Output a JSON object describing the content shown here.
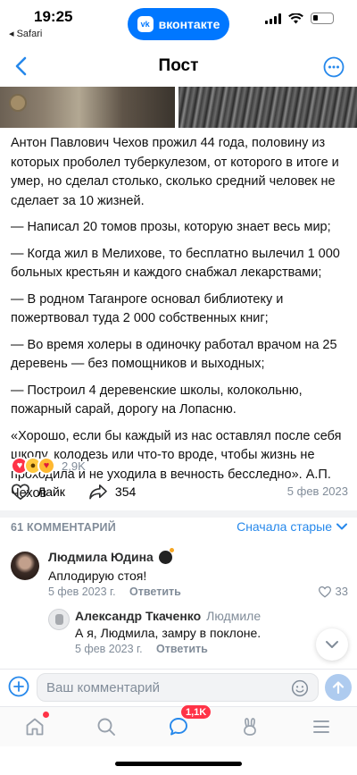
{
  "status": {
    "time": "19:25",
    "back_app": "◂ Safari",
    "pill_label": "вконтакте",
    "vk_logo": "vk"
  },
  "nav": {
    "title": "Пост"
  },
  "post": {
    "paragraphs": [
      "Антон Павлович Чехов прожил 44 года, половину из которых проболел туберкулезом, от которого в итоге и умер, но сделал столько, сколько средний человек не сделает за 10 жизней.",
      "— Написал 20 томов прозы, которую знает весь мир;",
      "— Когда жил в Мелихове, то бесплатно вылечил 1 000 больных крестьян и каждого снабжал лекарствами;",
      "— В родном Таганроге основал библиотеку и пожертвовал туда 2 000 собственных книг;",
      "— Во время холеры в одиночку работал врачом на 25 деревень — без помощников и выходных;",
      "— Построил 4 деревенские школы, колокольню, пожарный сарай, дорогу на Лопасню.",
      "«Хорошо, если бы каждый из нас оставлял после себя школу, колодезь или что-то вроде, чтобы жизнь не проходила и не уходила в вечность бесследно». А.П. Чехов"
    ],
    "reactions_count": "2,9K",
    "like_label": "Лайк",
    "shares": "354",
    "date": "5 фев 2023"
  },
  "comments": {
    "header": "61 КОММЕНТАРИЙ",
    "sort_label": "Сначала старые",
    "items": [
      {
        "author": "Людмила Юдина",
        "text": "Аплодирую стоя!",
        "date": "5 фев 2023 г.",
        "reply_label": "Ответить",
        "likes": "33"
      },
      {
        "author": "Александр Ткаченко",
        "reply_to": "Людмиле",
        "text": "А я, Людмила, замру в поклоне.",
        "date": "5 фев 2023 г.",
        "reply_label": "Ответить"
      }
    ]
  },
  "composer": {
    "placeholder": "Ваш комментарий"
  },
  "tabbar": {
    "messages_badge": "1,1K"
  },
  "colors": {
    "accent": "#2688eb",
    "vk_blue": "#0077ff",
    "badge_red": "#ff3347",
    "secondary_text": "#818c99"
  }
}
